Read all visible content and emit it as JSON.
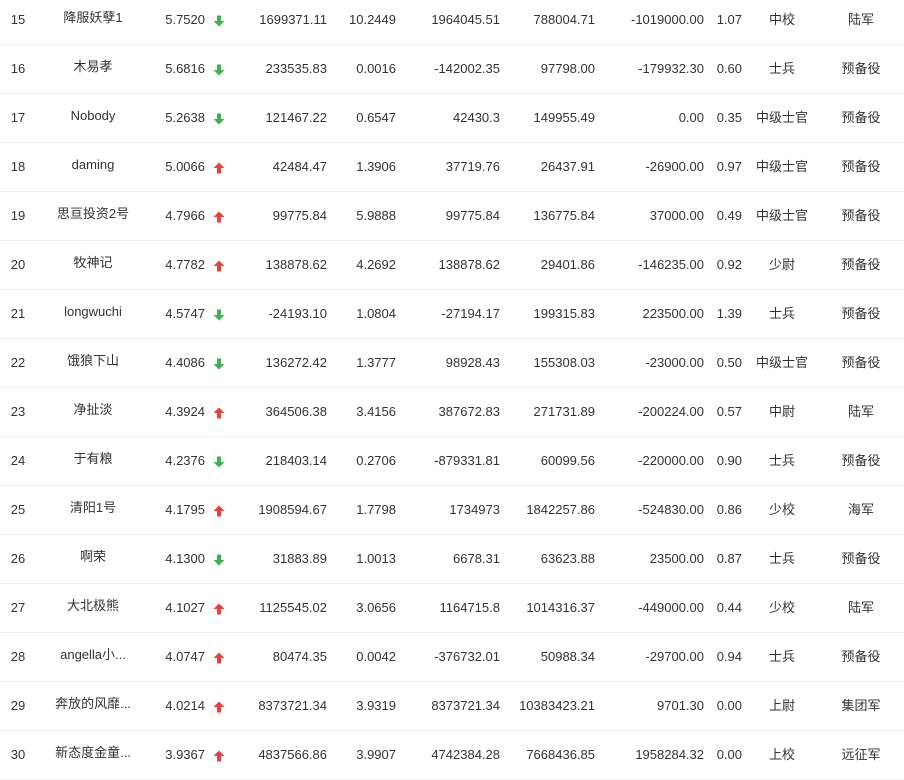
{
  "colors": {
    "up": "#e8413c",
    "down": "#3fb34f",
    "text": "#333333",
    "divider": "#eeeeee"
  },
  "rows": [
    {
      "rank": "15",
      "name": "降服妖孽1",
      "score": "5.7520",
      "trend": "down",
      "v1": "1699371.11",
      "v2": "10.2449",
      "v3": "1964045.51",
      "v4": "788004.71",
      "v5": "-1019000.00",
      "v6": "1.07",
      "military_rank": "中校",
      "service": "陆军"
    },
    {
      "rank": "16",
      "name": "木易孝",
      "score": "5.6816",
      "trend": "down",
      "v1": "233535.83",
      "v2": "0.0016",
      "v3": "-142002.35",
      "v4": "97798.00",
      "v5": "-179932.30",
      "v6": "0.60",
      "military_rank": "士兵",
      "service": "预备役"
    },
    {
      "rank": "17",
      "name": "Nobody",
      "score": "5.2638",
      "trend": "down",
      "v1": "121467.22",
      "v2": "0.6547",
      "v3": "42430.3",
      "v4": "149955.49",
      "v5": "0.00",
      "v6": "0.35",
      "military_rank": "中级士官",
      "service": "预备役"
    },
    {
      "rank": "18",
      "name": "daming",
      "score": "5.0066",
      "trend": "up",
      "v1": "42484.47",
      "v2": "1.3906",
      "v3": "37719.76",
      "v4": "26437.91",
      "v5": "-26900.00",
      "v6": "0.97",
      "military_rank": "中级士官",
      "service": "预备役"
    },
    {
      "rank": "19",
      "name": "思亘投资2号",
      "score": "4.7966",
      "trend": "up",
      "v1": "99775.84",
      "v2": "5.9888",
      "v3": "99775.84",
      "v4": "136775.84",
      "v5": "37000.00",
      "v6": "0.49",
      "military_rank": "中级士官",
      "service": "预备役"
    },
    {
      "rank": "20",
      "name": "牧神记",
      "score": "4.7782",
      "trend": "up",
      "v1": "138878.62",
      "v2": "4.2692",
      "v3": "138878.62",
      "v4": "29401.86",
      "v5": "-146235.00",
      "v6": "0.92",
      "military_rank": "少尉",
      "service": "预备役"
    },
    {
      "rank": "21",
      "name": "longwuchi",
      "score": "4.5747",
      "trend": "down",
      "v1": "-24193.10",
      "v2": "1.0804",
      "v3": "-27194.17",
      "v4": "199315.83",
      "v5": "223500.00",
      "v6": "1.39",
      "military_rank": "士兵",
      "service": "预备役"
    },
    {
      "rank": "22",
      "name": "饿狼下山",
      "score": "4.4086",
      "trend": "down",
      "v1": "136272.42",
      "v2": "1.3777",
      "v3": "98928.43",
      "v4": "155308.03",
      "v5": "-23000.00",
      "v6": "0.50",
      "military_rank": "中级士官",
      "service": "预备役"
    },
    {
      "rank": "23",
      "name": "净扯淡",
      "score": "4.3924",
      "trend": "up",
      "v1": "364506.38",
      "v2": "3.4156",
      "v3": "387672.83",
      "v4": "271731.89",
      "v5": "-200224.00",
      "v6": "0.57",
      "military_rank": "中尉",
      "service": "陆军"
    },
    {
      "rank": "24",
      "name": "于有粮",
      "score": "4.2376",
      "trend": "down",
      "v1": "218403.14",
      "v2": "0.2706",
      "v3": "-879331.81",
      "v4": "60099.56",
      "v5": "-220000.00",
      "v6": "0.90",
      "military_rank": "士兵",
      "service": "预备役"
    },
    {
      "rank": "25",
      "name": "清阳1号",
      "score": "4.1795",
      "trend": "up",
      "v1": "1908594.67",
      "v2": "1.7798",
      "v3": "1734973",
      "v4": "1842257.86",
      "v5": "-524830.00",
      "v6": "0.86",
      "military_rank": "少校",
      "service": "海军"
    },
    {
      "rank": "26",
      "name": "啊荣",
      "score": "4.1300",
      "trend": "down",
      "v1": "31883.89",
      "v2": "1.0013",
      "v3": "6678.31",
      "v4": "63623.88",
      "v5": "23500.00",
      "v6": "0.87",
      "military_rank": "士兵",
      "service": "预备役"
    },
    {
      "rank": "27",
      "name": "大北极熊",
      "score": "4.1027",
      "trend": "up",
      "v1": "1125545.02",
      "v2": "3.0656",
      "v3": "1164715.8",
      "v4": "1014316.37",
      "v5": "-449000.00",
      "v6": "0.44",
      "military_rank": "少校",
      "service": "陆军"
    },
    {
      "rank": "28",
      "name": "angella小...",
      "score": "4.0747",
      "trend": "up",
      "v1": "80474.35",
      "v2": "0.0042",
      "v3": "-376732.01",
      "v4": "50988.34",
      "v5": "-29700.00",
      "v6": "0.94",
      "military_rank": "士兵",
      "service": "预备役"
    },
    {
      "rank": "29",
      "name": "奔放的风靡...",
      "score": "4.0214",
      "trend": "up",
      "v1": "8373721.34",
      "v2": "3.9319",
      "v3": "8373721.34",
      "v4": "10383423.21",
      "v5": "9701.30",
      "v6": "0.00",
      "military_rank": "上尉",
      "service": "集团军"
    },
    {
      "rank": "30",
      "name": "新态度金童...",
      "score": "3.9367",
      "trend": "up",
      "v1": "4837566.86",
      "v2": "3.9907",
      "v3": "4742384.28",
      "v4": "7668436.85",
      "v5": "1958284.32",
      "v6": "0.00",
      "military_rank": "上校",
      "service": "远征军"
    }
  ]
}
